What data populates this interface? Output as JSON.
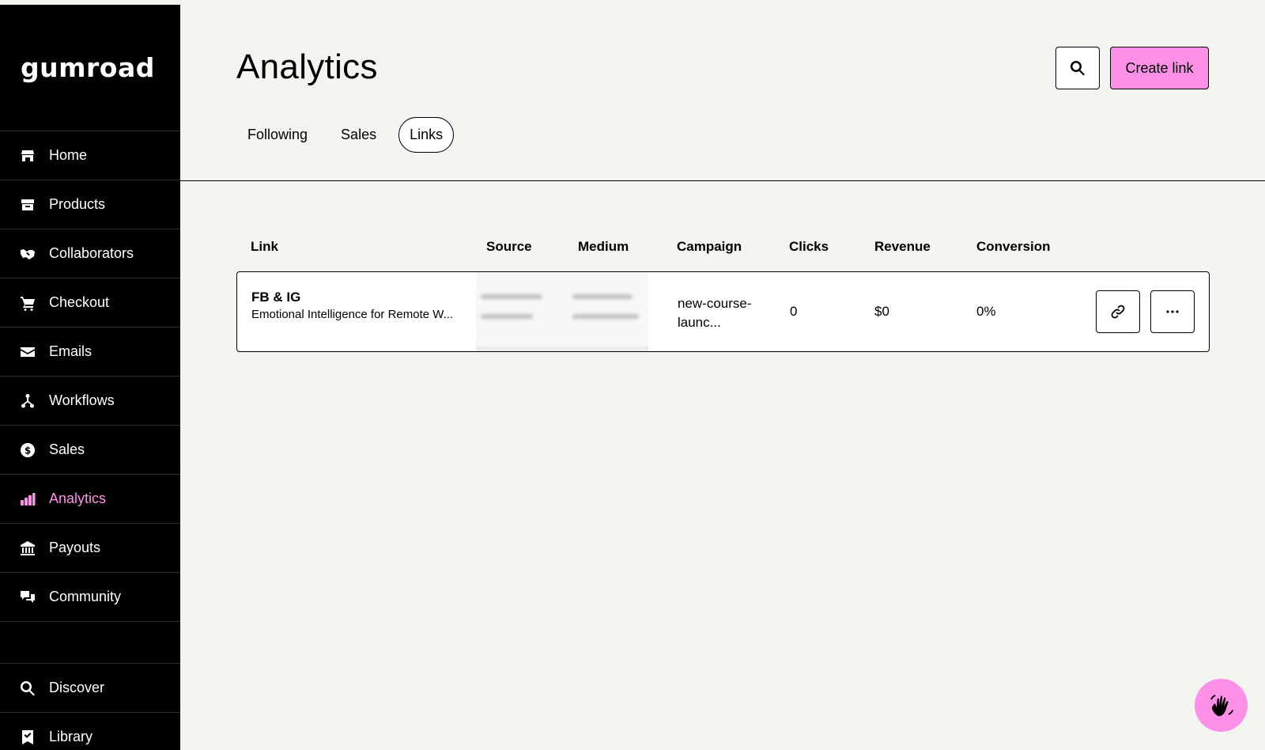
{
  "brand": {
    "logo_text": "gumroad",
    "accent_color": "#ff90e8"
  },
  "sidebar": {
    "items": [
      {
        "label": "Home",
        "icon": "store-icon"
      },
      {
        "label": "Products",
        "icon": "archive-icon"
      },
      {
        "label": "Collaborators",
        "icon": "handshake-icon"
      },
      {
        "label": "Checkout",
        "icon": "cart-icon"
      },
      {
        "label": "Emails",
        "icon": "envelope-icon"
      },
      {
        "label": "Workflows",
        "icon": "workflow-icon"
      },
      {
        "label": "Sales",
        "icon": "dollar-circle-icon"
      },
      {
        "label": "Analytics",
        "icon": "bar-chart-icon",
        "active": true
      },
      {
        "label": "Payouts",
        "icon": "bank-icon"
      },
      {
        "label": "Community",
        "icon": "chat-bubbles-icon"
      }
    ],
    "bottom_items": [
      {
        "label": "Discover",
        "icon": "search-icon"
      },
      {
        "label": "Library",
        "icon": "bookmark-icon"
      }
    ]
  },
  "header": {
    "title": "Analytics",
    "tabs": [
      {
        "label": "Following",
        "active": false
      },
      {
        "label": "Sales",
        "active": false
      },
      {
        "label": "Links",
        "active": true
      }
    ],
    "search_icon": "search-icon",
    "create_label": "Create link"
  },
  "table": {
    "columns": [
      "Link",
      "Source",
      "Medium",
      "Campaign",
      "Clicks",
      "Revenue",
      "Conversion"
    ],
    "rows": [
      {
        "link_title": "FB & IG",
        "link_subtitle": "Emotional Intelligence for Remote W...",
        "campaign": "new-course-launc...",
        "clicks": "0",
        "revenue": "$0",
        "conversion": "0%"
      }
    ]
  },
  "actions": {
    "copy_icon": "link-icon",
    "more_icon": "more-horizontal-icon"
  },
  "help": {
    "icon": "hand-wave-icon"
  }
}
